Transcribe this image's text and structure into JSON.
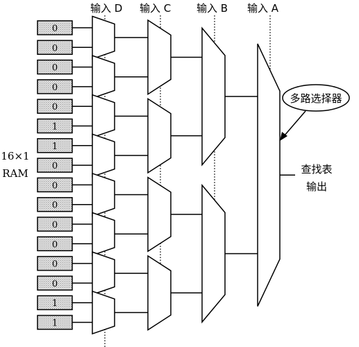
{
  "inputs": {
    "d": "输入 D",
    "c": "输入 C",
    "b": "输入 B",
    "a": "输入 A"
  },
  "ram": {
    "line1": "16×1",
    "line2": "RAM",
    "bits": [
      "0",
      "0",
      "0",
      "0",
      "0",
      "1",
      "1",
      "0",
      "0",
      "0",
      "0",
      "0",
      "0",
      "0",
      "1",
      "1"
    ]
  },
  "mux_callout": "多路选择器",
  "lut_output": {
    "line1": "查找表",
    "line2": "输出"
  }
}
